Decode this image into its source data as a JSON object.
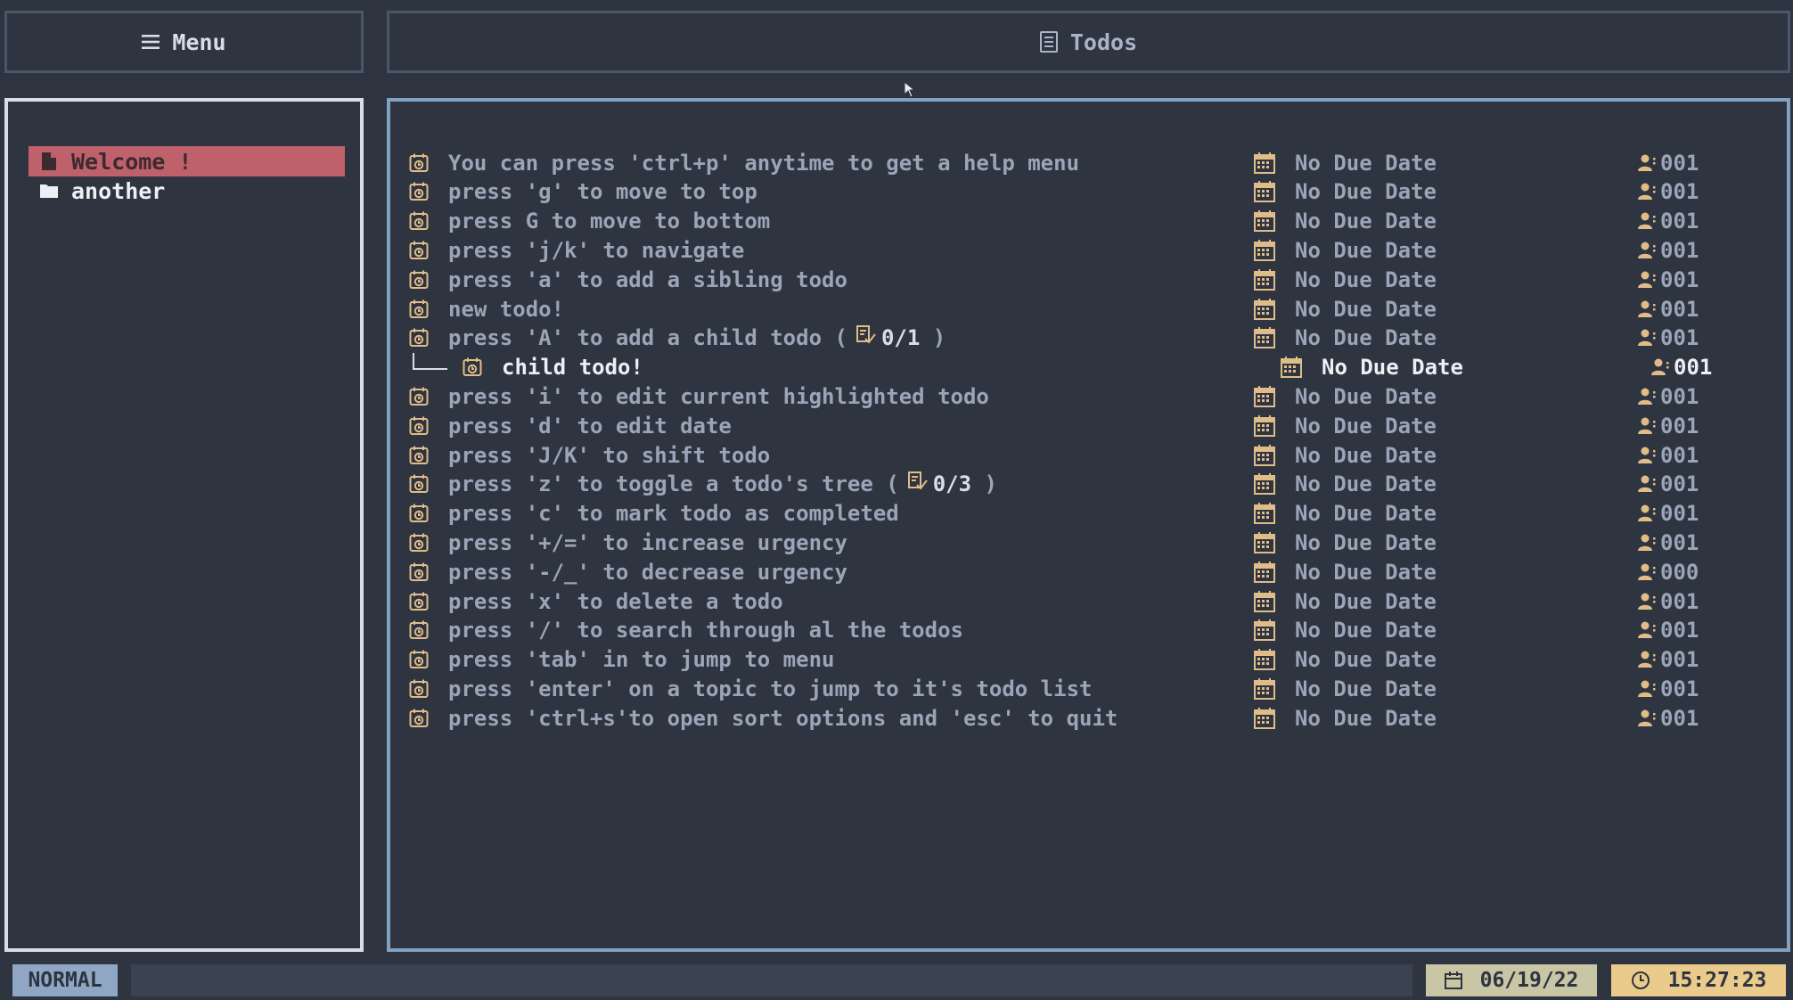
{
  "header": {
    "menu_label": "Menu",
    "todos_label": "Todos"
  },
  "sidebar": {
    "topics": [
      {
        "label": "Welcome !",
        "icon": "file-icon",
        "selected": true
      },
      {
        "label": "another",
        "icon": "folder-icon",
        "selected": false
      }
    ]
  },
  "todos": [
    {
      "title": "You can press 'ctrl+p' anytime to get a help menu",
      "due": "No Due Date",
      "urgency": "001"
    },
    {
      "title": "press 'g' to move to top",
      "due": "No Due Date",
      "urgency": "001"
    },
    {
      "title": "press G to move to bottom",
      "due": "No Due Date",
      "urgency": "001"
    },
    {
      "title": "press 'j/k' to navigate",
      "due": "No Due Date",
      "urgency": "001"
    },
    {
      "title": "press 'a' to add a sibling todo",
      "due": "No Due Date",
      "urgency": "001"
    },
    {
      "title": "new todo!",
      "due": "No Due Date",
      "urgency": "001"
    },
    {
      "title": "press 'A' to add a child todo",
      "progress": "0/1",
      "due": "No Due Date",
      "urgency": "001"
    },
    {
      "title": "child todo!",
      "child": true,
      "due": "No Due Date",
      "urgency": "001"
    },
    {
      "title": "press 'i' to edit current highlighted todo",
      "due": "No Due Date",
      "urgency": "001"
    },
    {
      "title": "press 'd' to edit date",
      "due": "No Due Date",
      "urgency": "001"
    },
    {
      "title": "press 'J/K' to shift todo",
      "due": "No Due Date",
      "urgency": "001"
    },
    {
      "title": "press 'z' to toggle a todo's tree",
      "progress": "0/3",
      "due": "No Due Date",
      "urgency": "001"
    },
    {
      "title": "press 'c' to mark todo as completed",
      "due": "No Due Date",
      "urgency": "001"
    },
    {
      "title": "press '+/=' to increase urgency",
      "due": "No Due Date",
      "urgency": "001"
    },
    {
      "title": "press '-/_' to decrease urgency",
      "due": "No Due Date",
      "urgency": "000"
    },
    {
      "title": "press 'x' to delete a todo",
      "due": "No Due Date",
      "urgency": "001"
    },
    {
      "title": "press '/' to search through al the todos",
      "due": "No Due Date",
      "urgency": "001"
    },
    {
      "title": "press 'tab' in to jump to menu",
      "due": "No Due Date",
      "urgency": "001"
    },
    {
      "title": "press 'enter' on a topic to jump to it's todo list",
      "due": "No Due Date",
      "urgency": "001"
    },
    {
      "title": "press 'ctrl+s'to open sort options and 'esc' to quit",
      "due": "No Due Date",
      "urgency": "001"
    }
  ],
  "status_bar": {
    "mode": "NORMAL",
    "date": "06/19/22",
    "time": "15:27:23"
  },
  "colors": {
    "background": "#2e3440",
    "selected_topic": "#bf616a",
    "panel_border_active": "#81a1c1",
    "icon_accent": "#e0bc88",
    "date_badge": "#c8c6a4",
    "time_badge": "#ebcb8b",
    "mode_badge": "#8fa6c4"
  }
}
